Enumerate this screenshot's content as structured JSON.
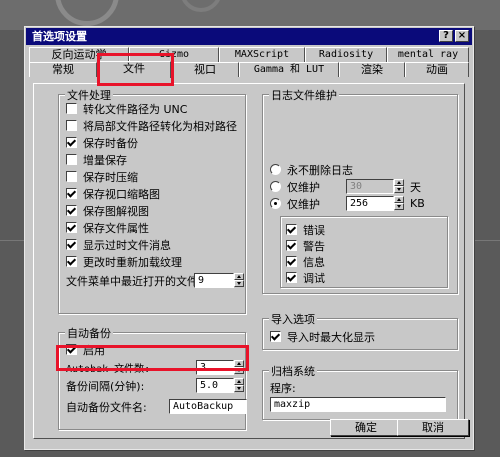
{
  "dialog": {
    "title": "首选项设置",
    "help_glyph": "?",
    "close_glyph": "×"
  },
  "tabs_back": [
    {
      "label": "反向运动学"
    },
    {
      "label": "Gizmo"
    },
    {
      "label": "MAXScript"
    },
    {
      "label": "Radiosity"
    },
    {
      "label": "mental ray"
    }
  ],
  "tabs_front": [
    {
      "label": "常规"
    },
    {
      "label": "文件"
    },
    {
      "label": "视口"
    },
    {
      "label": "Gamma 和 LUT"
    },
    {
      "label": "渲染"
    },
    {
      "label": "动画"
    }
  ],
  "file_handling": {
    "title": "文件处理",
    "options": [
      {
        "label": "转化文件路径为 UNC",
        "checked": false
      },
      {
        "label": "将局部文件路径转化为相对路径",
        "checked": false
      },
      {
        "label": "保存时备份",
        "checked": true
      },
      {
        "label": "增量保存",
        "checked": false
      },
      {
        "label": "保存时压缩",
        "checked": false
      },
      {
        "label": "保存视口缩略图",
        "checked": true
      },
      {
        "label": "保存图解视图",
        "checked": true
      },
      {
        "label": "保存文件属性",
        "checked": true
      },
      {
        "label": "显示过时文件消息",
        "checked": true
      },
      {
        "label": "更改时重新加载纹理",
        "checked": true
      }
    ],
    "recent_files_label": "文件菜单中最近打开的文件:",
    "recent_files_value": "9"
  },
  "auto_backup": {
    "title": "自动备份",
    "enable_label": "启用",
    "enable_checked": true,
    "count_label": "Autobak 文件数:",
    "count_value": "3",
    "interval_label": "备份间隔(分钟):",
    "interval_value": "5.0",
    "filename_label": "自动备份文件名:",
    "filename_value": "AutoBackup"
  },
  "log": {
    "title": "日志文件维护",
    "radios": [
      {
        "label": "永不删除日志",
        "checked": false
      },
      {
        "label": "仅维护",
        "checked": false,
        "value": "30",
        "unit": "天",
        "disabled": true
      },
      {
        "label": "仅维护",
        "checked": true,
        "value": "256",
        "unit": "KB",
        "disabled": false
      }
    ],
    "levels": [
      {
        "label": "错误",
        "checked": true
      },
      {
        "label": "警告",
        "checked": true
      },
      {
        "label": "信息",
        "checked": true
      },
      {
        "label": "调试",
        "checked": true
      }
    ]
  },
  "import": {
    "title": "导入选项",
    "maximize_label": "导入时最大化显示",
    "maximize_checked": true
  },
  "archive": {
    "title": "归档系统",
    "program_label": "程序:",
    "program_value": "maxzip"
  },
  "buttons": {
    "ok": "确定",
    "cancel": "取消"
  }
}
